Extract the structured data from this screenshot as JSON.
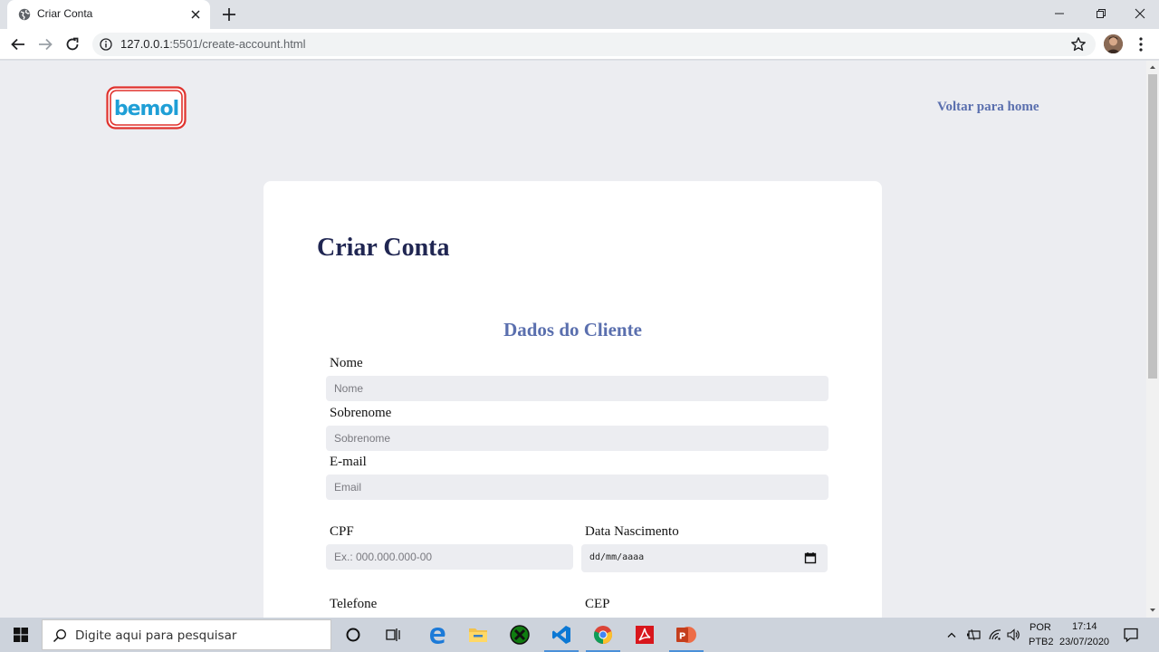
{
  "browser": {
    "tab_title": "Criar Conta",
    "url_host": "127.0.0.1",
    "url_rest": ":5501/create-account.html"
  },
  "page": {
    "back_link": "Voltar para home",
    "title": "Criar Conta",
    "section_title": "Dados do Cliente",
    "fields": {
      "nome": {
        "label": "Nome",
        "placeholder": "Nome"
      },
      "sobrenome": {
        "label": "Sobrenome",
        "placeholder": "Sobrenome"
      },
      "email": {
        "label": "E-mail",
        "placeholder": "Email"
      },
      "cpf": {
        "label": "CPF",
        "placeholder": "Ex.: 000.000.000-00"
      },
      "nascimento": {
        "label": "Data Nascimento",
        "value": "dd/mm/aaaa"
      },
      "telefone": {
        "label": "Telefone"
      },
      "cep": {
        "label": "CEP"
      }
    },
    "logo_text": "bemol"
  },
  "taskbar": {
    "search_placeholder": "Digite aqui para pesquisar",
    "lang_top": "POR",
    "lang_bottom": "PTB2",
    "time": "17:14",
    "date": "23/07/2020"
  }
}
